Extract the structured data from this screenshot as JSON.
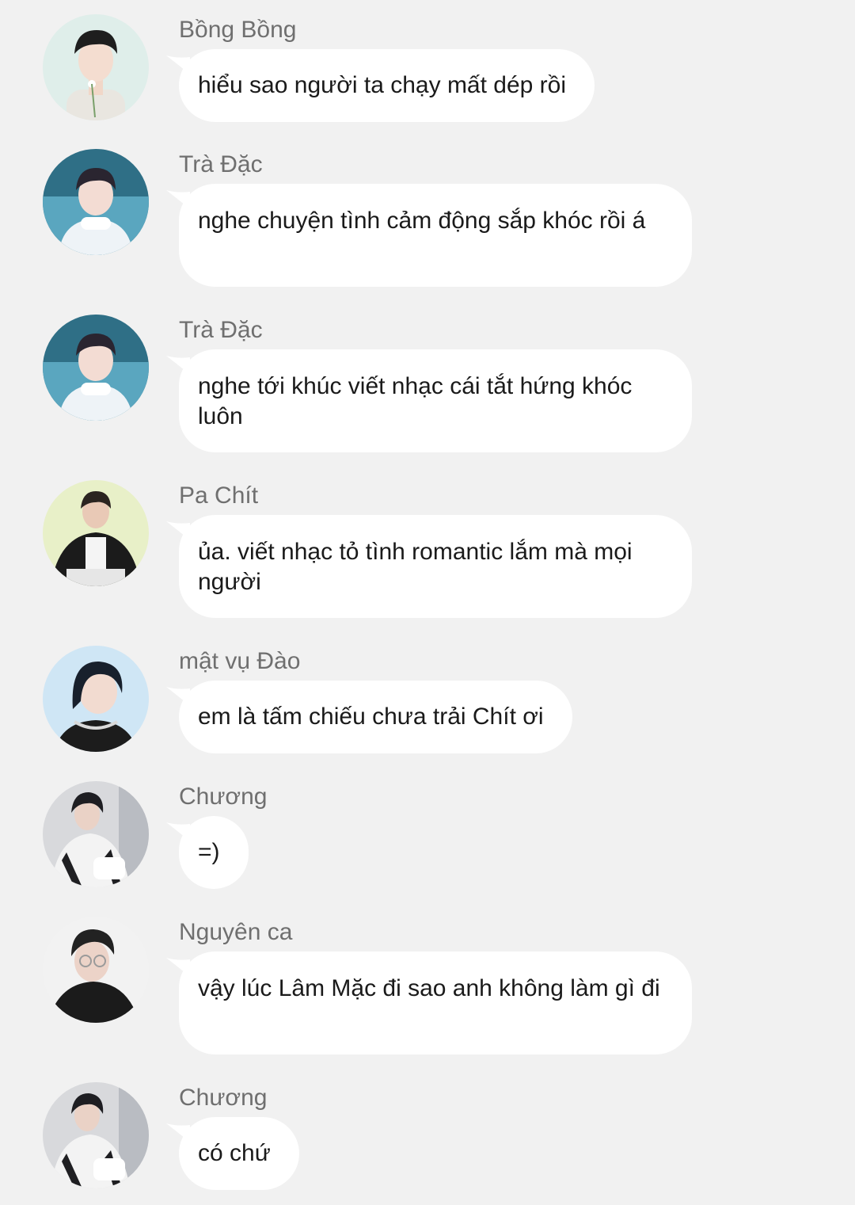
{
  "messages": [
    {
      "sender": "Bồng Bồng",
      "text": "hiểu sao người ta chạy mất dép rồi",
      "avatar_icon": "avatar-bong-bong"
    },
    {
      "sender": "Trà Đặc",
      "text": "nghe chuyện tình cảm động sắp khóc rồi á",
      "avatar_icon": "avatar-tra-dac"
    },
    {
      "sender": "Trà Đặc",
      "text": "nghe tới khúc viết nhạc cái tắt hứng khóc luôn",
      "avatar_icon": "avatar-tra-dac"
    },
    {
      "sender": "Pa Chít",
      "text": "ủa. viết nhạc tỏ tình romantic lắm mà mọi người",
      "avatar_icon": "avatar-pa-chit"
    },
    {
      "sender": "mật vụ Đào",
      "text": "em là tấm chiếu chưa trải Chít ơi",
      "avatar_icon": "avatar-mat-vu-dao"
    },
    {
      "sender": "Chương",
      "text": "=)",
      "avatar_icon": "avatar-chuong"
    },
    {
      "sender": "Nguyên ca",
      "text": "vậy lúc Lâm Mặc đi sao anh không làm gì đi",
      "avatar_icon": "avatar-nguyen-ca"
    },
    {
      "sender": "Chương",
      "text": "có chứ",
      "avatar_icon": "avatar-chuong"
    }
  ],
  "colors": {
    "background": "#f1f1f1",
    "bubble": "#ffffff",
    "sender_text": "#6f6f6f",
    "message_text": "#1a1a1a"
  }
}
